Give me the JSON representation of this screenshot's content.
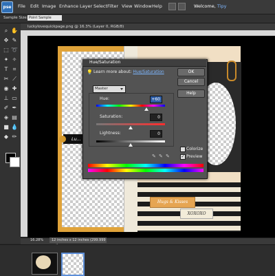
{
  "app": {
    "logo": "pse"
  },
  "menu": {
    "items": [
      "File",
      "Edit",
      "Image",
      "Enhance",
      "Layer",
      "Select",
      "Filter",
      "View",
      "Window",
      "Help"
    ],
    "welcome_prefix": "Welcome,",
    "user": "Tipy"
  },
  "options_bar": {
    "sample_size_label": "Sample Size:",
    "sample_size_value": "Point Sample"
  },
  "document": {
    "title": "luckylovequickpage.png @ 16.3% (Layer 0, RGB/8)",
    "zoom": "16.28%",
    "doc_size": "12 inches x 12 inches (299.999 ppi)"
  },
  "canvas": {
    "label_tag": "Lu...",
    "tag1": "Hugs & Kisses",
    "tag2": "XOXOXO"
  },
  "dialog": {
    "title": "Hue/Saturation",
    "learn_prefix": "Learn more about:",
    "learn_link": "Hue/Saturation",
    "ok": "OK",
    "cancel": "Cancel",
    "help": "Help",
    "edit_value": "Master",
    "hue_label": "Hue:",
    "hue_value": "+60",
    "saturation_label": "Saturation:",
    "saturation_value": "0",
    "lightness_label": "Lightness:",
    "lightness_value": "0",
    "colorize_label": "Colorize",
    "colorize_checked": false,
    "preview_label": "Preview",
    "preview_checked": true
  },
  "colors": {
    "accent": "#2f6fb6",
    "link": "#7eb7ff",
    "frame_orange": "#e0a33a"
  }
}
